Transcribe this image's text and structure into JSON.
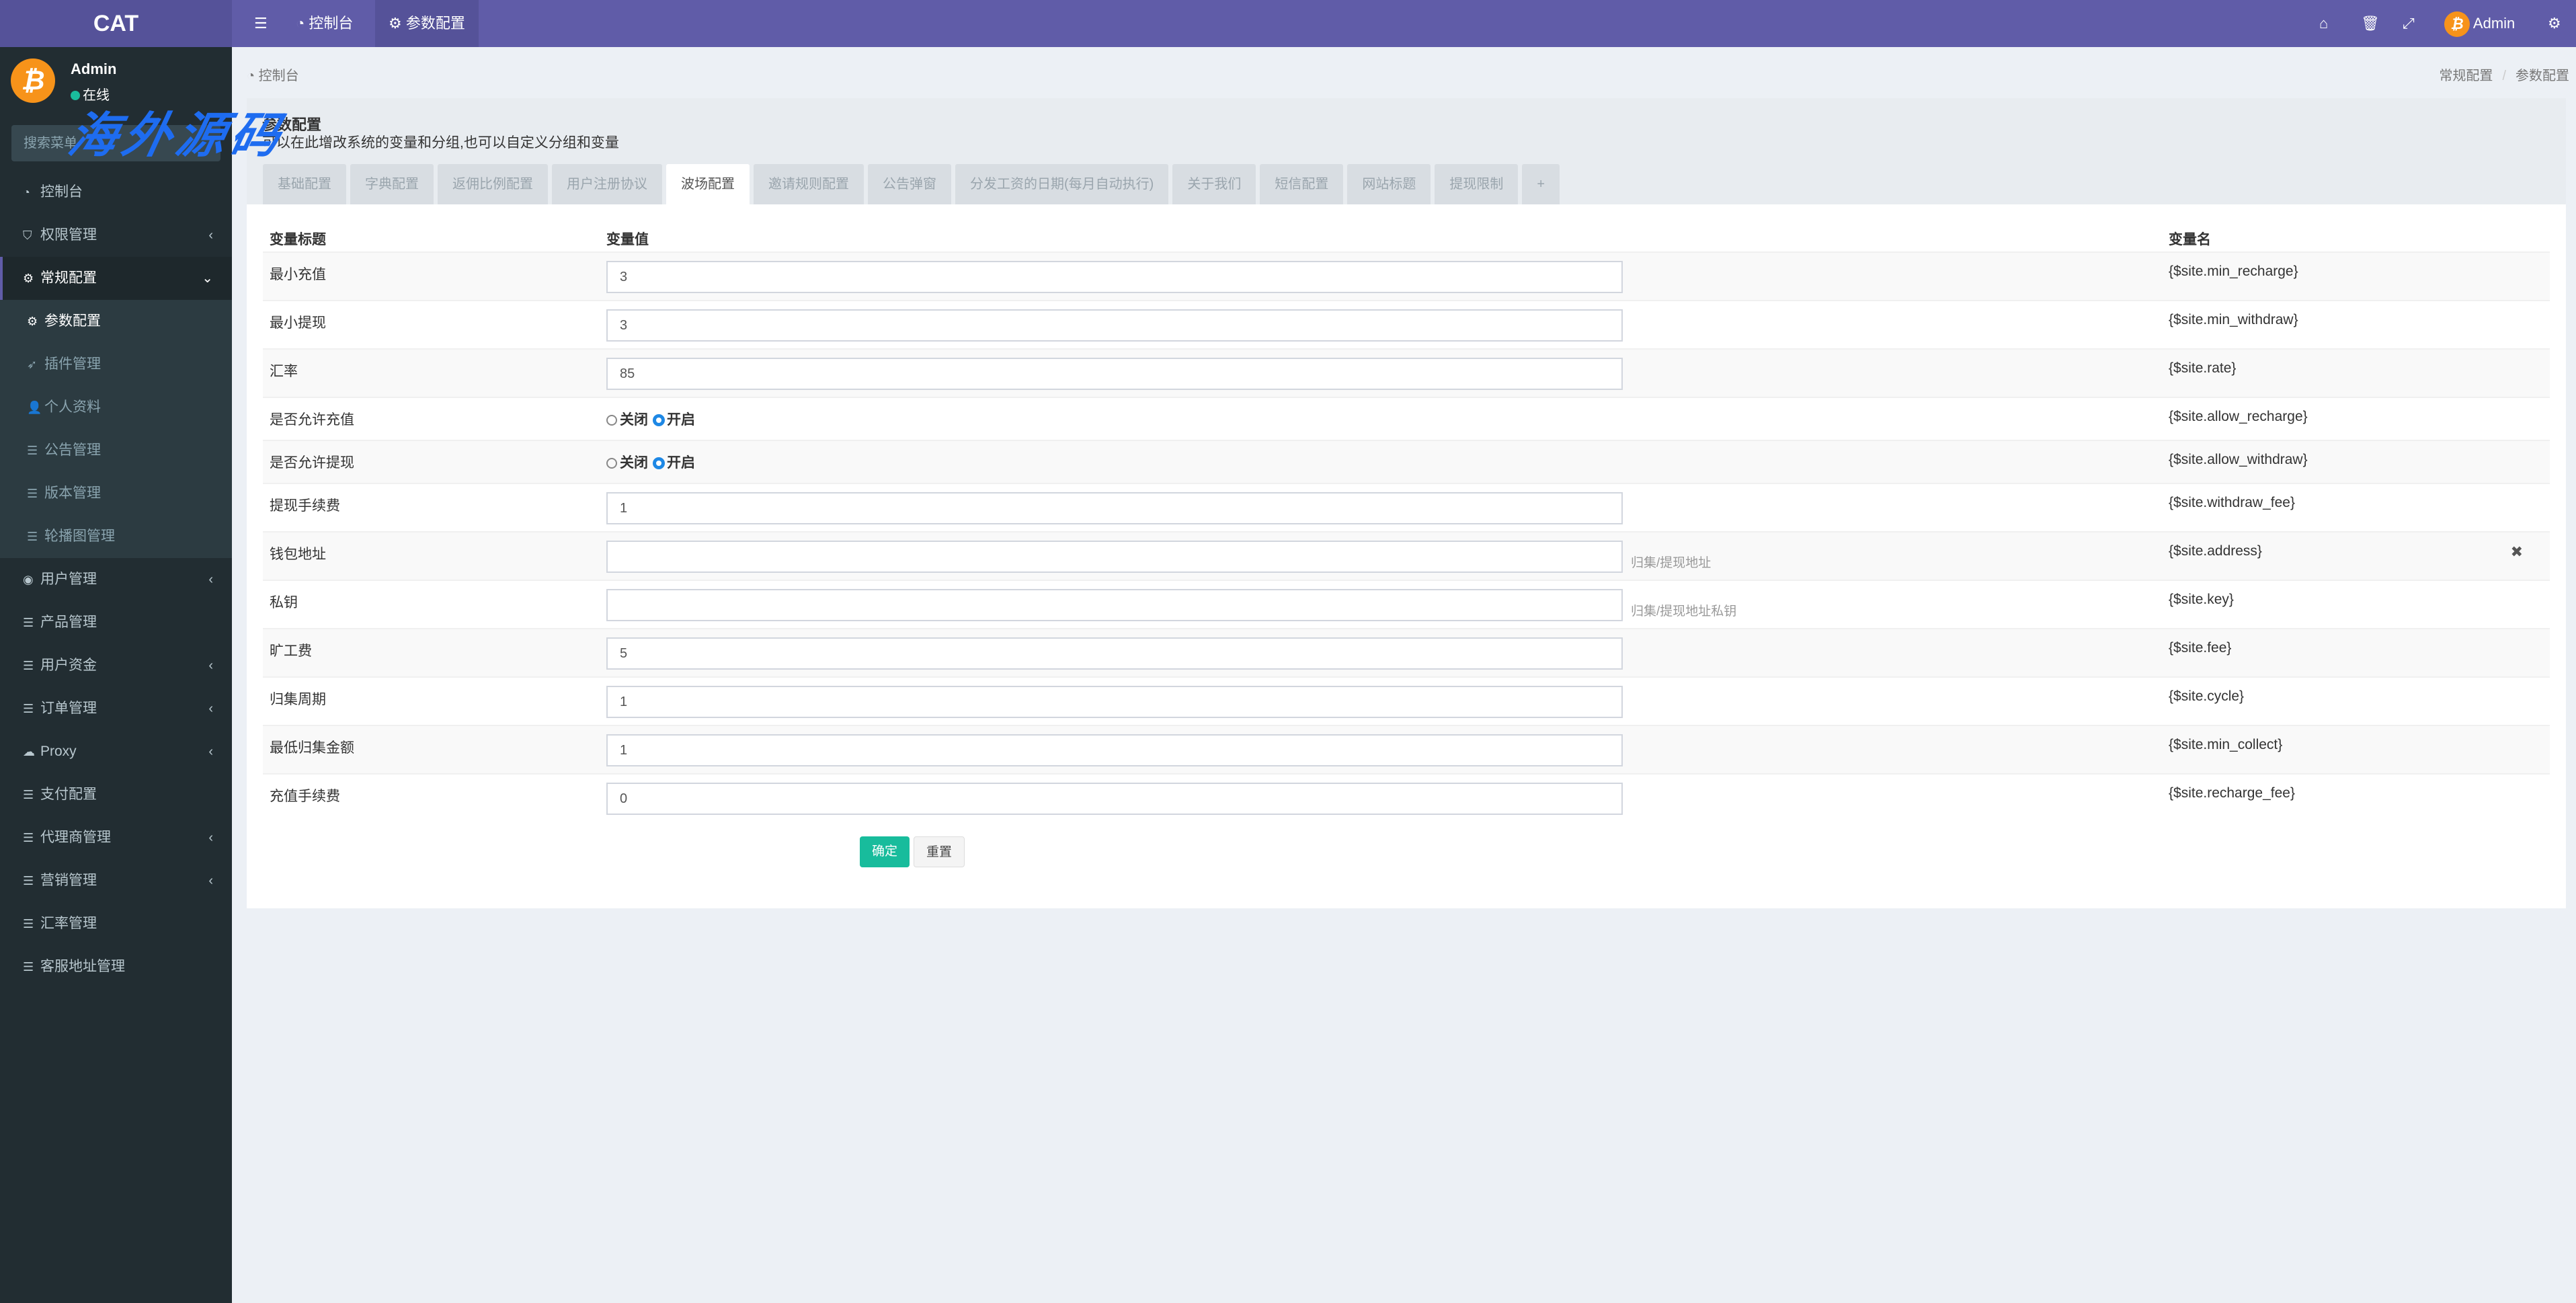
{
  "header": {
    "logo": "CAT",
    "menu_icon": "bars-icon",
    "nav": [
      {
        "icon": "dashboard-icon",
        "label": "控制台"
      },
      {
        "icon": "gear-icon",
        "label": "参数配置"
      }
    ],
    "right": {
      "home_icon": "home-icon",
      "trash_icon": "trash-icon",
      "fullscreen_icon": "expand-icon",
      "user": "Admin",
      "settings_icon": "cogs-icon"
    }
  },
  "sidebar": {
    "user": {
      "name": "Admin",
      "status": "在线"
    },
    "search_placeholder": "搜索菜单",
    "watermark": "海外源码",
    "items": [
      {
        "icon": "dashboard-icon",
        "glyph": "◔",
        "label": "控制台"
      },
      {
        "icon": "shield-icon",
        "glyph": "⛉",
        "label": "权限管理",
        "arrow": "‹"
      },
      {
        "icon": "cogs-icon",
        "glyph": "⚙",
        "label": "常规配置",
        "arrow": "⌄",
        "open": true
      },
      {
        "icon": "gear-icon",
        "glyph": "⚙",
        "label": "参数配置",
        "sub": true,
        "active": true
      },
      {
        "icon": "rocket-icon",
        "glyph": "➶",
        "label": "插件管理",
        "sub": true
      },
      {
        "icon": "user-icon",
        "glyph": "👤",
        "label": "个人资料",
        "sub": true
      },
      {
        "icon": "list-icon",
        "glyph": "☰",
        "label": "公告管理",
        "sub": true
      },
      {
        "icon": "list-icon",
        "glyph": "☰",
        "label": "版本管理",
        "sub": true
      },
      {
        "icon": "list-icon",
        "glyph": "☰",
        "label": "轮播图管理",
        "sub": true
      },
      {
        "icon": "user-circle-icon",
        "glyph": "◉",
        "label": "用户管理",
        "arrow": "‹"
      },
      {
        "icon": "list-icon",
        "glyph": "☰",
        "label": "产品管理"
      },
      {
        "icon": "list-icon",
        "glyph": "☰",
        "label": "用户资金",
        "arrow": "‹"
      },
      {
        "icon": "list-icon",
        "glyph": "☰",
        "label": "订单管理",
        "arrow": "‹"
      },
      {
        "icon": "cloud-icon",
        "glyph": "☁",
        "label": "Proxy",
        "arrow": "‹"
      },
      {
        "icon": "list-icon",
        "glyph": "☰",
        "label": "支付配置"
      },
      {
        "icon": "list-icon",
        "glyph": "☰",
        "label": "代理商管理",
        "arrow": "‹"
      },
      {
        "icon": "list-icon",
        "glyph": "☰",
        "label": "营销管理",
        "arrow": "‹"
      },
      {
        "icon": "list-icon",
        "glyph": "☰",
        "label": "汇率管理"
      },
      {
        "icon": "list-icon",
        "glyph": "☰",
        "label": "客服地址管理"
      }
    ]
  },
  "breadcrumb": {
    "left": "控制台",
    "right": [
      "常规配置",
      "参数配置"
    ]
  },
  "panel": {
    "title": "参数配置",
    "description": "可以在此增改系统的变量和分组,也可以自定义分组和变量",
    "tabs": [
      "基础配置",
      "字典配置",
      "返佣比例配置",
      "用户注册协议",
      "波场配置",
      "邀请规则配置",
      "公告弹窗",
      "分发工资的日期(每月自动执行)",
      "关于我们",
      "短信配置",
      "网站标题",
      "提现限制",
      "+"
    ],
    "active_tab": 4,
    "columns": [
      "变量标题",
      "变量值",
      "变量名"
    ],
    "rows": [
      {
        "title": "最小充值",
        "value": "3",
        "var": "{$site.min_recharge}"
      },
      {
        "title": "最小提现",
        "value": "3",
        "var": "{$site.min_withdraw}"
      },
      {
        "title": "汇率",
        "value": "85",
        "var": "{$site.rate}"
      },
      {
        "title": "是否允许充值",
        "radio": [
          "关闭",
          "开启"
        ],
        "selected": "开启",
        "var": "{$site.allow_recharge}"
      },
      {
        "title": "是否允许提现",
        "radio": [
          "关闭",
          "开启"
        ],
        "selected": "开启",
        "var": "{$site.allow_withdraw}"
      },
      {
        "title": "提现手续费",
        "value": "1",
        "var": "{$site.withdraw_fee}"
      },
      {
        "title": "钱包地址",
        "value": "",
        "hint": "归集/提现地址",
        "var": "{$site.address}",
        "delete": "✖"
      },
      {
        "title": "私钥",
        "value": "",
        "hint": "归集/提现地址私钥",
        "var": "{$site.key}"
      },
      {
        "title": "旷工费",
        "value": "5",
        "var": "{$site.fee}"
      },
      {
        "title": "归集周期",
        "value": "1",
        "var": "{$site.cycle}"
      },
      {
        "title": "最低归集金额",
        "value": "1",
        "var": "{$site.min_collect}"
      },
      {
        "title": "充值手续费",
        "value": "0",
        "var": "{$site.recharge_fee}"
      }
    ],
    "buttons": {
      "submit": "确定",
      "reset": "重置"
    }
  },
  "colors": {
    "header": "#605ca8",
    "sidebar": "#222d32",
    "primary": "#18bc9c",
    "avatar": "#f7931a"
  }
}
